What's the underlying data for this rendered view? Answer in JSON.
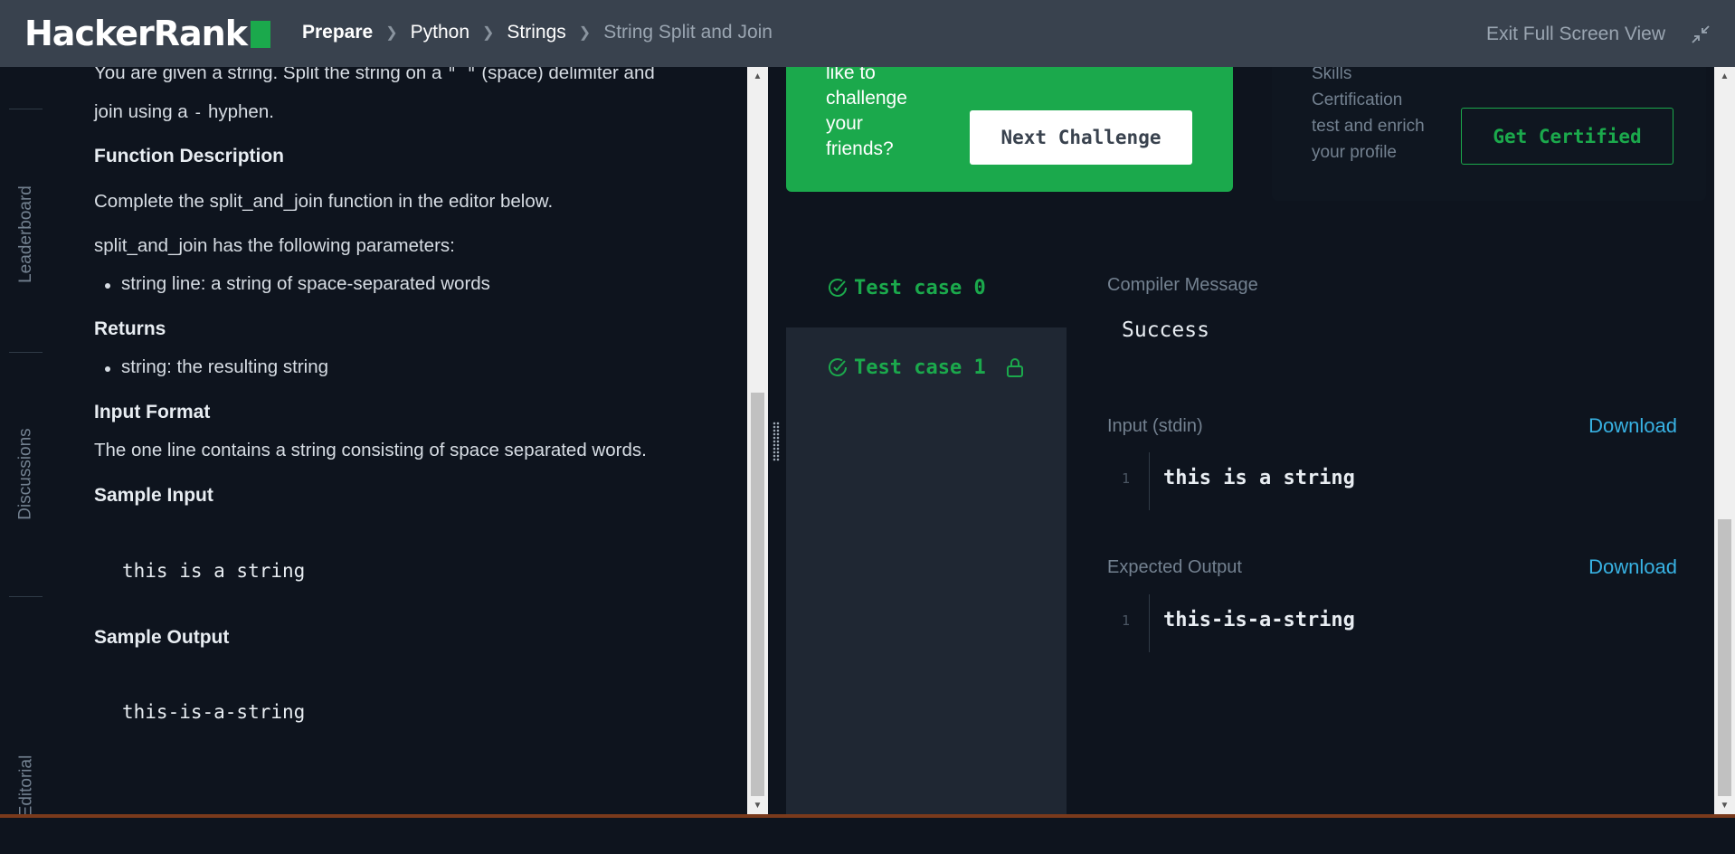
{
  "header": {
    "logo_text": "HackerRank",
    "breadcrumb": [
      "Prepare",
      "Python",
      "Strings",
      "String Split and Join"
    ],
    "exit_label": "Exit Full Screen View",
    "brand_color": "#1ba94c"
  },
  "sidebar": {
    "tabs": [
      "Leaderboard",
      "Discussions",
      "Editorial"
    ]
  },
  "problem": {
    "intro_line1_a": "You are given a string. Split the string on a ",
    "intro_line1_code": "\" \"",
    "intro_line1_b": " (space) delimiter and",
    "intro_line2_a": "join using a ",
    "intro_line2_code": "-",
    "intro_line2_b": " hyphen.",
    "function_heading": "Function Description",
    "function_text": "Complete the split_and_join function in the editor below.",
    "params_text": "split_and_join has the following parameters:",
    "params": [
      "string line: a string of space-separated words"
    ],
    "returns_heading": "Returns",
    "returns": [
      "string: the resulting string"
    ],
    "input_heading": "Input Format",
    "input_text": "The one line contains a string consisting of space separated words.",
    "sample_input_heading": "Sample Input",
    "sample_input": "this is a string",
    "sample_output_heading": "Sample Output",
    "sample_output": "this-is-a-string"
  },
  "promo": {
    "challenge_lines": [
      "like to",
      "challenge",
      "your",
      "friends?"
    ],
    "next_button": "Next Challenge",
    "cert_lines": [
      "Skills",
      "Certification",
      "test and enrich",
      "your profile"
    ],
    "cert_button": "Get Certified"
  },
  "tests": {
    "cases": [
      "Test case 0",
      "Test case 1"
    ],
    "status_color": "#1ba94c"
  },
  "result": {
    "compiler_label": "Compiler Message",
    "compiler_message": "Success",
    "input_label": "Input (stdin)",
    "download_label": "Download",
    "input_line_no": "1",
    "input_value": "this is a string",
    "expected_label": "Expected Output",
    "expected_line_no": "1",
    "expected_value": "this-is-a-string"
  }
}
